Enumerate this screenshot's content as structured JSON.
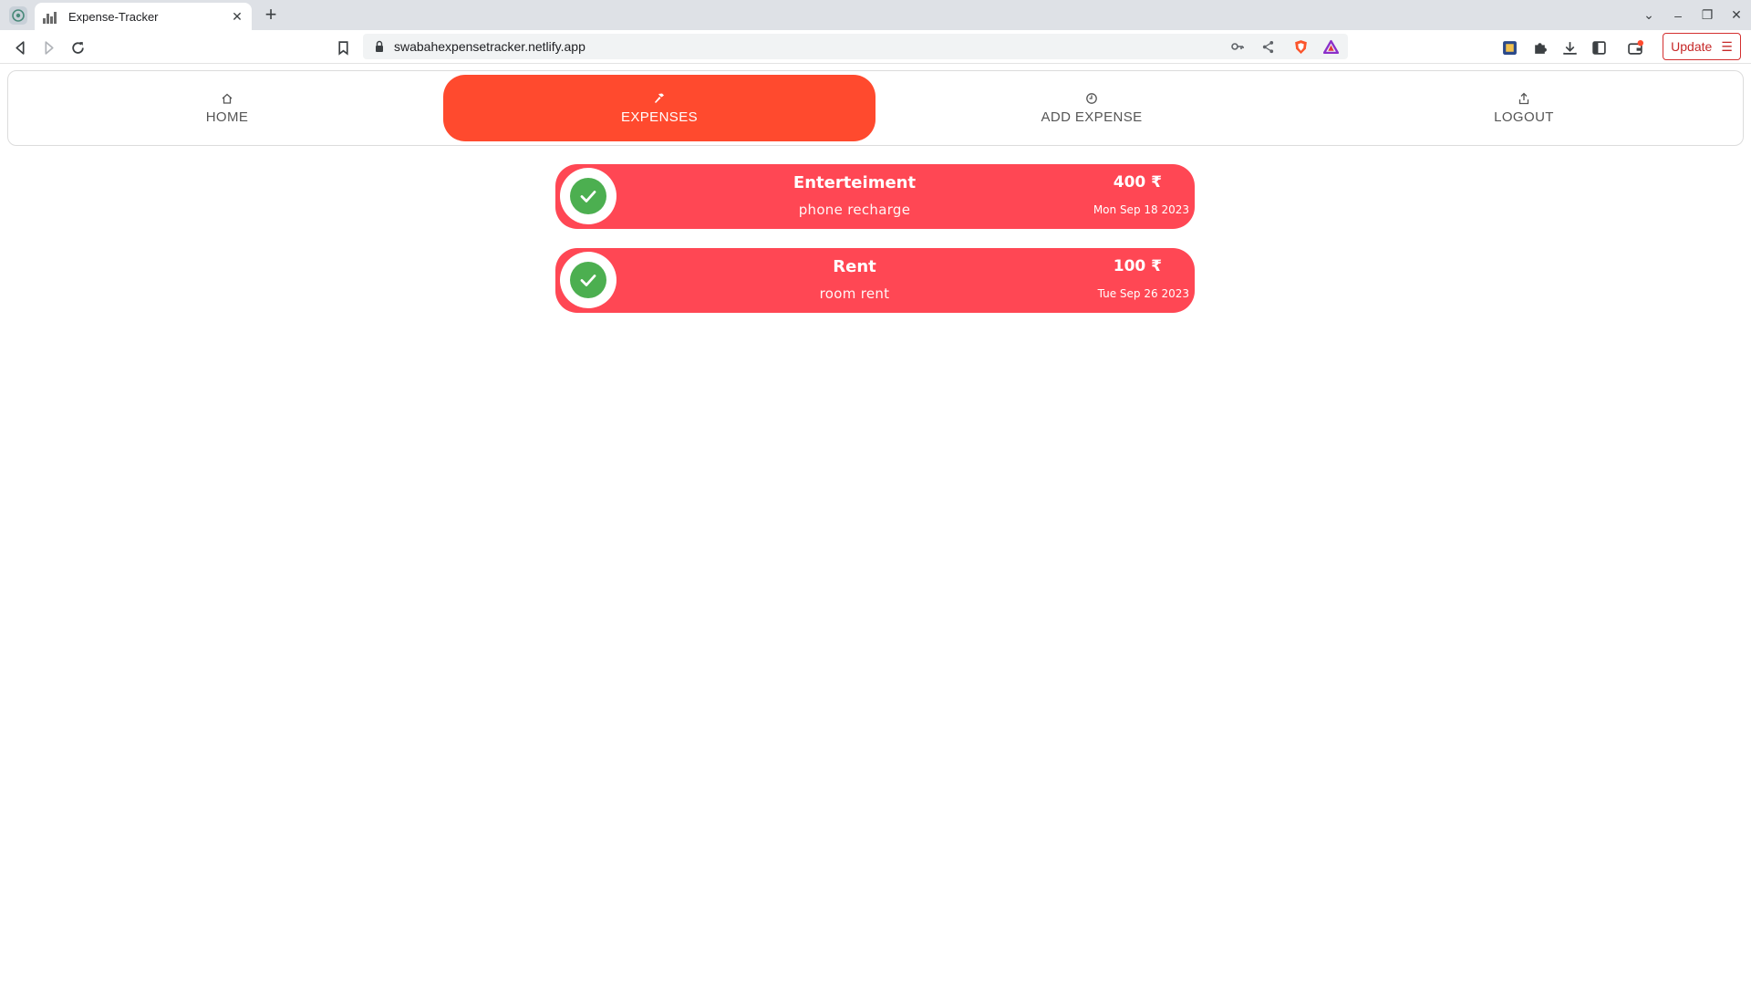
{
  "browser": {
    "tab_title": "Expense-Tracker",
    "tab_close": "✕",
    "new_tab": "+",
    "url": "swabahexpensetracker.netlify.app",
    "update_label": "Update",
    "update_menu": "☰",
    "window_controls": {
      "tab_search": "⌄",
      "minimize": "–",
      "restore": "❐",
      "close": "✕"
    },
    "icons": [
      "back-icon",
      "forward-icon",
      "reload-icon",
      "bookmark-icon",
      "lock-icon",
      "key-icon",
      "share-icon",
      "brave-shield-icon",
      "brave-rewards-icon",
      "extension-app-icon",
      "puzzle-icon",
      "download-icon",
      "sidebar-icon",
      "wallet-icon"
    ]
  },
  "nav": {
    "items": [
      {
        "label": "HOME",
        "icon": "home-icon",
        "active": false
      },
      {
        "label": "EXPENSES",
        "icon": "hammer-icon",
        "active": true
      },
      {
        "label": "ADD EXPENSE",
        "icon": "clock-icon",
        "active": false
      },
      {
        "label": "LOGOUT",
        "icon": "upload-icon",
        "active": false
      }
    ]
  },
  "expenses": [
    {
      "title": "Enterteiment",
      "description": "phone recharge",
      "amount": "400 ₹",
      "date": "Mon Sep 18 2023"
    },
    {
      "title": "Rent",
      "description": "room rent",
      "amount": "100 ₹",
      "date": "Tue Sep 26 2023"
    }
  ],
  "colors": {
    "nav_active": "#ff4a2e",
    "card": "#ff4754",
    "check": "#4caf50",
    "update": "#c62828"
  }
}
